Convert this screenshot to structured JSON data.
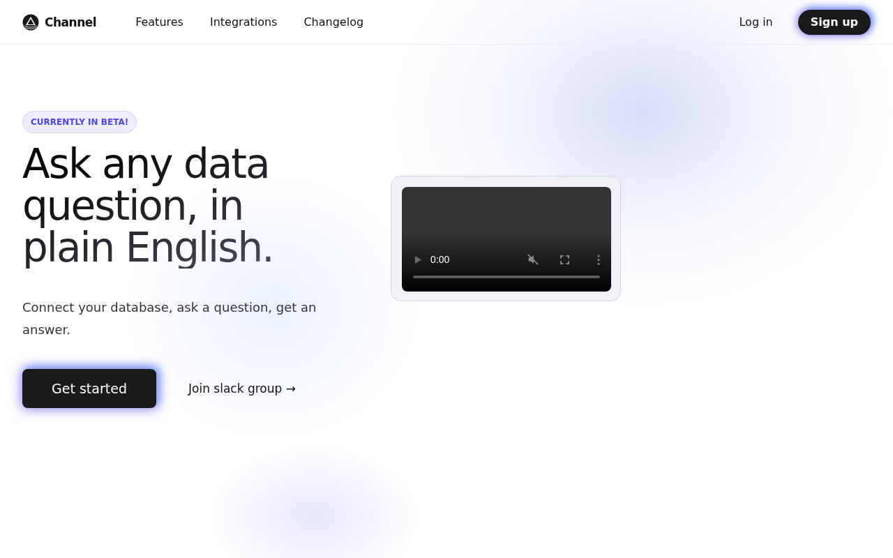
{
  "header": {
    "brand": "Channel",
    "nav": [
      {
        "label": "Features"
      },
      {
        "label": "Integrations"
      },
      {
        "label": "Changelog"
      }
    ],
    "login": "Log in",
    "signup": "Sign up"
  },
  "hero": {
    "badge": "CURRENTLY IN BETA!",
    "heading": "Ask any data question, in plain English.",
    "subtitle": "Connect your database, ask a question, get an answer.",
    "primary_button": "Get started",
    "secondary_link": "Join slack group →"
  },
  "video": {
    "time": "0:00",
    "muted": true
  }
}
